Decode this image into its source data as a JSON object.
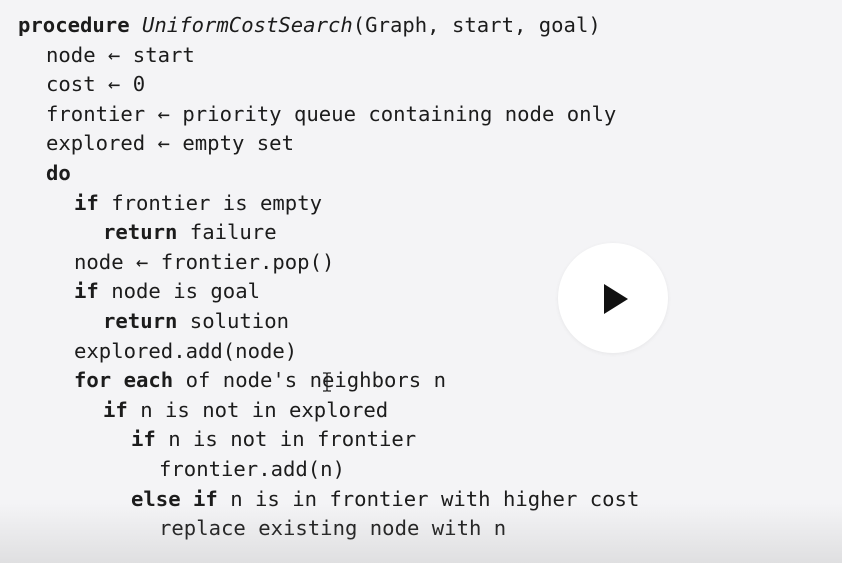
{
  "code": {
    "line1": {
      "kw": "procedure",
      "fn": "UniformCostSearch",
      "rest": "(Graph, start, goal)"
    },
    "line2": "node ← start",
    "line3": "cost ← 0",
    "line4": "frontier ← priority queue containing node only",
    "line5": "explored ← empty set",
    "line6": {
      "kw": "do"
    },
    "line7": {
      "kw": "if",
      "rest": " frontier is empty"
    },
    "line8": {
      "kw": "return",
      "rest": " failure"
    },
    "line9": "node ← frontier.pop()",
    "line10": {
      "kw": "if",
      "rest": " node is goal"
    },
    "line11": {
      "kw": "return",
      "rest": " solution"
    },
    "line12": "explored.add(node)",
    "line13": {
      "kw": "for each",
      "rest": " of node's neighbors n"
    },
    "line14": {
      "kw": "if",
      "rest": " n is not in explored"
    },
    "line15": {
      "kw": "if",
      "rest": " n is not in frontier"
    },
    "line16": "frontier.add(n)",
    "line17": {
      "kw": "else if",
      "rest": " n is in frontier with higher cost"
    },
    "line18": "replace existing node with n"
  },
  "player": {
    "play_icon": "play-icon"
  },
  "cursor": {
    "icon": "text-cursor-icon"
  }
}
